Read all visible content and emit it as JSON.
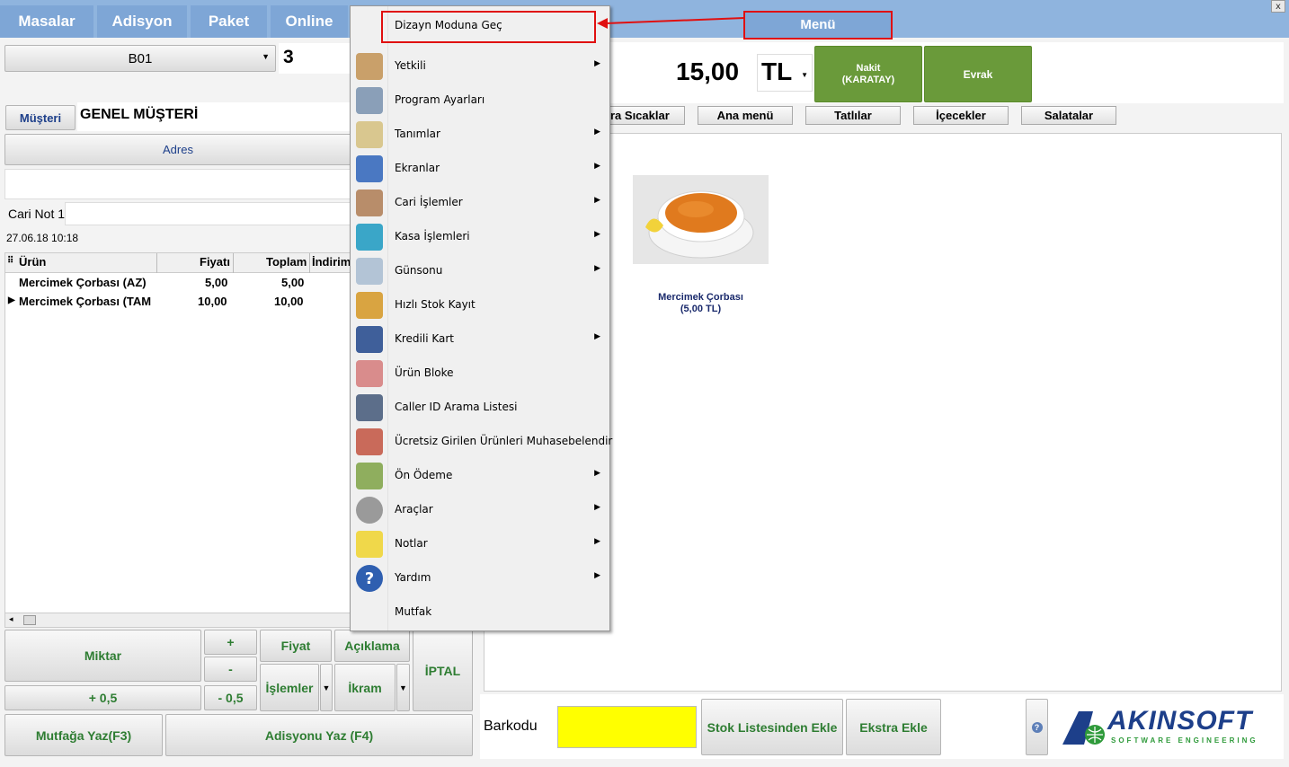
{
  "top_tabs": [
    "Masalar",
    "Adisyon",
    "Paket",
    "Online"
  ],
  "menu_title": "Menü",
  "window_close": "x",
  "table_select": "B01",
  "person_count": "3",
  "customer_button": "Müşteri",
  "customer_name": "GENEL MÜŞTERİ",
  "address_button": "Adres",
  "cari_note_label": "Cari Not 1",
  "datetime": "27.06.18 10:18",
  "grid": {
    "headers": [
      "Ürün",
      "Fiyatı",
      "Toplam",
      "İndirim"
    ],
    "rows": [
      {
        "name": "Mercimek Çorbası (AZ)",
        "price": "5,00",
        "total": "5,00"
      },
      {
        "name": "Mercimek Çorbası (TAM",
        "price": "10,00",
        "total": "10,00"
      }
    ]
  },
  "buttons": {
    "miktar": "Miktar",
    "plus": "+",
    "minus": "-",
    "plus_half": "+ 0,5",
    "minus_half": "- 0,5",
    "fiyat": "Fiyat",
    "aciklama": "Açıklama",
    "islemler": "İşlemler",
    "ikram": "İkram",
    "iptal": "İPTAL",
    "mutfaga_yaz": "Mutfağa Yaz(F3)",
    "adisyonu_yaz": "Adisyonu Yaz (F4)"
  },
  "total": {
    "amount": "15,00",
    "currency": "TL"
  },
  "payment_buttons": {
    "nakit": "Nakit\n(KARATAY)",
    "evrak": "Evrak"
  },
  "categories": [
    "ra Sıcaklar",
    "Ana menü",
    "Tatlılar",
    "İçecekler",
    "Salatalar"
  ],
  "product": {
    "name": "Mercimek Çorbası",
    "price": "(5,00 TL)"
  },
  "barcode_label": "Barkodu",
  "stock_list_button": "Stok Listesinden Ekle",
  "extra_button": "Ekstra Ekle",
  "help_button": "?",
  "logo": {
    "name": "AKINSOFT",
    "tagline": "SOFTWARE ENGINEERING"
  },
  "menu": {
    "items": [
      {
        "label": "Dizayn Moduna Geç",
        "icon": "design-mode-icon",
        "submenu": false
      },
      {
        "label": "Yetkili",
        "icon": "authorized-users-icon",
        "submenu": true
      },
      {
        "label": "Program Ayarları",
        "icon": "program-settings-icon",
        "submenu": false
      },
      {
        "label": "Tanımlar",
        "icon": "definitions-clipboard-icon",
        "submenu": true
      },
      {
        "label": "Ekranlar",
        "icon": "screens-icon",
        "submenu": true
      },
      {
        "label": "Cari İşlemler",
        "icon": "account-operations-icon",
        "submenu": true
      },
      {
        "label": "Kasa İşlemleri",
        "icon": "cash-operations-icon",
        "submenu": true
      },
      {
        "label": "Günsonu",
        "icon": "end-of-day-icon",
        "submenu": true
      },
      {
        "label": "Hızlı Stok Kayıt",
        "icon": "quick-stock-icon",
        "submenu": false
      },
      {
        "label": "Kredili Kart",
        "icon": "credit-card-icon",
        "submenu": true
      },
      {
        "label": "Ürün Bloke",
        "icon": "product-block-icon",
        "submenu": false
      },
      {
        "label": "Caller ID Arama Listesi",
        "icon": "caller-id-icon",
        "submenu": false
      },
      {
        "label": "Ücretsiz Girilen Ürünleri Muhasebelendir",
        "icon": "free-products-accounting-icon",
        "submenu": false
      },
      {
        "label": "Ön Ödeme",
        "icon": "prepayment-money-icon",
        "submenu": true
      },
      {
        "label": "Araçlar",
        "icon": "tools-gears-icon",
        "submenu": true
      },
      {
        "label": "Notlar",
        "icon": "notes-icon",
        "submenu": true
      },
      {
        "label": "Yardım",
        "icon": "help-icon",
        "submenu": true
      },
      {
        "label": "Mutfak",
        "icon": "",
        "submenu": false
      }
    ]
  },
  "colors": {
    "topbar": "#8fb4de",
    "tab": "#7ea6d6",
    "green_button": "#6a9a3a",
    "barcode_input": "#ffff00",
    "highlight_red": "#e01010",
    "logo_blue": "#1d3f8a",
    "logo_green": "#2e9a3a"
  }
}
